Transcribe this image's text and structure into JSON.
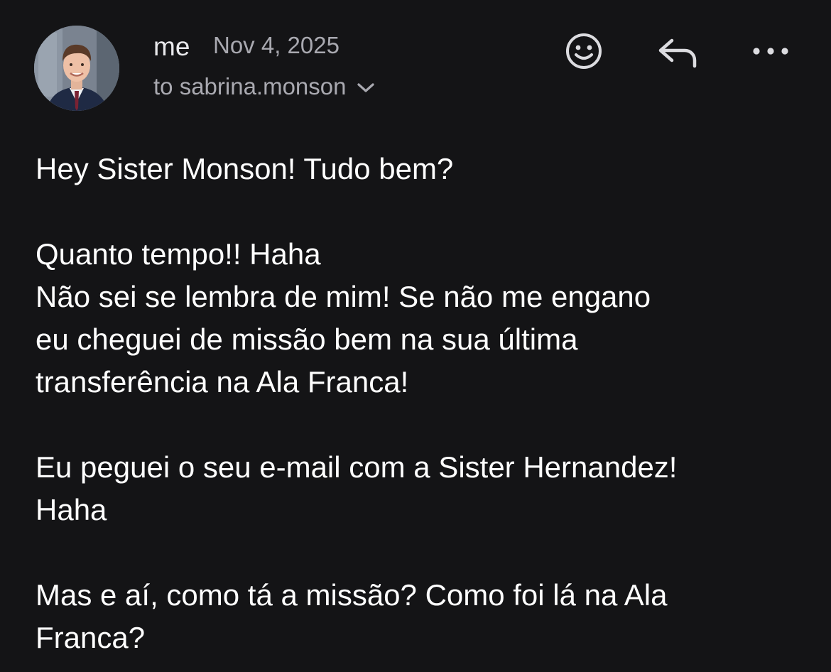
{
  "header": {
    "sender": "me",
    "date": "Nov 4, 2025",
    "recipient": "to sabrina.monson",
    "avatar_icon": "profile-photo",
    "actions": [
      {
        "name": "emoji-react",
        "icon": "smiley-face-icon"
      },
      {
        "name": "reply",
        "icon": "reply-arrow-icon"
      },
      {
        "name": "more",
        "icon": "more-horizontal-icon"
      }
    ]
  },
  "body": {
    "paragraphs": [
      [
        "Hey Sister Monson! Tudo bem?"
      ],
      [
        "Quanto tempo!! Haha",
        "Não sei se lembra de mim! Se não me engano",
        "eu cheguei de missão bem na sua última",
        "transferência na Ala Franca!"
      ],
      [
        "Eu peguei o seu e-mail com a Sister Hernandez!",
        "Haha"
      ],
      [
        "Mas e aí, como tá a missão? Como foi lá na Ala",
        "Franca?"
      ]
    ]
  },
  "colors": {
    "background": "#141416",
    "primary_text": "#ffffff",
    "secondary_text": "#a9a9b0",
    "icon": "#dcdce0"
  }
}
